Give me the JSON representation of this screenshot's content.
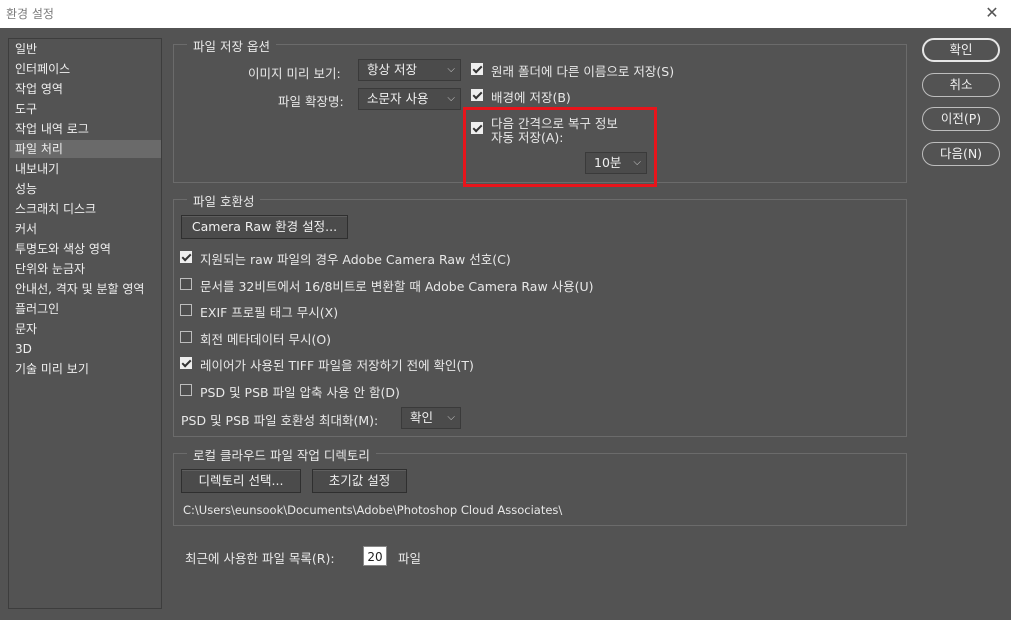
{
  "window": {
    "title": "환경 설정",
    "close_icon": "close-icon"
  },
  "sidebar": {
    "items": [
      {
        "label": "일반"
      },
      {
        "label": "인터페이스"
      },
      {
        "label": "작업 영역"
      },
      {
        "label": "도구"
      },
      {
        "label": "작업 내역 로그"
      },
      {
        "label": "파일 처리",
        "selected": true
      },
      {
        "label": "내보내기"
      },
      {
        "label": "성능"
      },
      {
        "label": "스크래치 디스크"
      },
      {
        "label": "커서"
      },
      {
        "label": "투명도와 색상 영역"
      },
      {
        "label": "단위와 눈금자"
      },
      {
        "label": "안내선, 격자 및 분할 영역"
      },
      {
        "label": "플러그인"
      },
      {
        "label": "문자"
      },
      {
        "label": "3D"
      },
      {
        "label": "기술 미리 보기"
      }
    ]
  },
  "save_options": {
    "legend": "파일 저장 옵션",
    "preview_label": "이미지 미리 보기:",
    "preview_value": "항상 저장",
    "extension_label": "파일 확장명:",
    "extension_value": "소문자 사용",
    "save_original_folder": {
      "label": "원래 폴더에 다른 이름으로 저장(S)",
      "checked": true
    },
    "save_background": {
      "label": "배경에 저장(B)",
      "checked": true
    },
    "autosave": {
      "label_line1": "다음 간격으로 복구 정보",
      "label_line2": "자동 저장(A):",
      "checked": true
    },
    "autosave_interval": "10분"
  },
  "compat": {
    "legend": "파일 호환성",
    "camera_raw_button": "Camera Raw 환경 설정...",
    "options": [
      {
        "label": "지원되는 raw 파일의 경우 Adobe Camera Raw 선호(C)",
        "checked": true
      },
      {
        "label": "문서를 32비트에서 16/8비트로 변환할 때 Adobe Camera Raw 사용(U)",
        "checked": false
      },
      {
        "label": "EXIF 프로필 태그 무시(X)",
        "checked": false
      },
      {
        "label": "회전 메타데이터 무시(O)",
        "checked": false
      },
      {
        "label": "레이어가 사용된 TIFF 파일을 저장하기 전에 확인(T)",
        "checked": true
      },
      {
        "label": "PSD 및 PSB 파일 압축 사용 안 함(D)",
        "checked": false
      }
    ],
    "maximize_label": "PSD 및 PSB 파일 호환성 최대화(M):",
    "maximize_value": "확인"
  },
  "cloud": {
    "legend": "로컬 클라우드 파일 작업 디렉토리",
    "select_dir_button": "디렉토리 선택...",
    "reset_button": "초기값 설정",
    "path": "C:\\Users\\eunsook\\Documents\\Adobe\\Photoshop Cloud Associates\\"
  },
  "recent": {
    "label": "최근에 사용한 파일 목록(R):",
    "value": "20",
    "unit": "파일"
  },
  "buttons": {
    "ok": "확인",
    "cancel": "취소",
    "prev": "이전(P)",
    "next": "다음(N)"
  },
  "colors": {
    "panel_bg": "#535353",
    "highlight_box": "#e8141b",
    "selected_item": "#6a6a6a"
  }
}
